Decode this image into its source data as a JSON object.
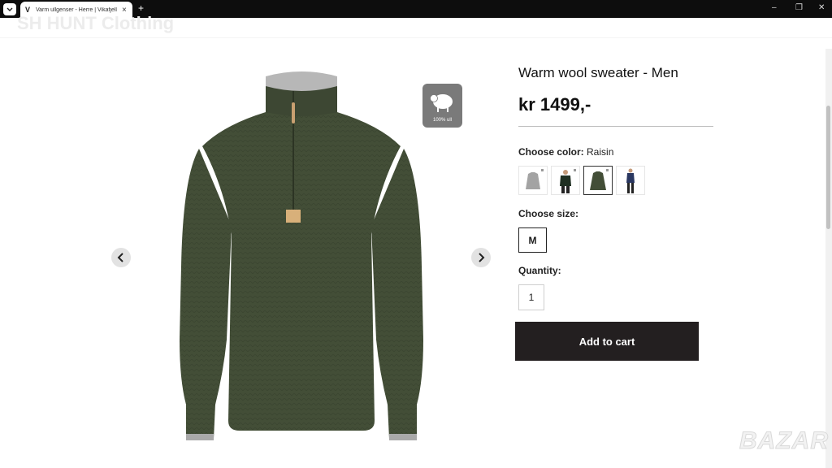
{
  "browser": {
    "tab_title": "Varm ullgenser - Herre | Vikafjell",
    "favicon": "V",
    "close_glyph": "×",
    "new_tab_glyph": "+",
    "window_controls": [
      "–",
      "❐",
      "✕"
    ]
  },
  "page": {
    "watermark": "SH HUNT Clothing",
    "badge_text": "100% ull",
    "bazar_logo": "BAZAR"
  },
  "product": {
    "title": "Warm wool sweater - Men",
    "price": "kr 1499,-",
    "color_label": "Choose color:",
    "color_value": "Raisin",
    "size_label": "Choose size:",
    "sizes": [
      "M"
    ],
    "quantity_label": "Quantity:",
    "quantity": "1",
    "add_to_cart": "Add to cart"
  },
  "colors": {
    "sweater": "#434e37",
    "accent": "#231f20"
  },
  "icons": {
    "prev": "chevron-left-icon",
    "next": "chevron-right-icon",
    "sheep": "sheep-icon"
  }
}
